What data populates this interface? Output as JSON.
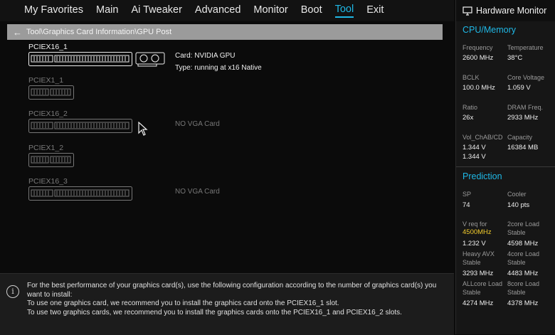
{
  "menu": [
    "My Favorites",
    "Main",
    "Ai Tweaker",
    "Advanced",
    "Monitor",
    "Boot",
    "Tool",
    "Exit"
  ],
  "active_menu": "Tool",
  "breadcrumb": "Tool\\Graphics Card Information\\GPU Post",
  "slots": [
    {
      "label": "PCIEX16_1",
      "card": "Card: NVIDIA GPU",
      "type": "Type: running at x16 Native"
    },
    {
      "label": "PCIEX1_1"
    },
    {
      "label": "PCIEX16_2",
      "status": "NO VGA Card"
    },
    {
      "label": "PCIEX1_2"
    },
    {
      "label": "PCIEX16_3",
      "status": "NO VGA Card"
    }
  ],
  "info": {
    "line1": "For the best performance of your graphics card(s), use the following configuration according to the number of graphics card(s) you",
    "line2": "want to install:",
    "line3": "To use one graphics card, we recommend you to install  the graphics card onto the PCIEX16_1 slot.",
    "line4": "To use two graphics cards, we recommend you to install the graphics cards onto the PCIEX16_1 and PCIEX16_2 slots."
  },
  "monitor": {
    "title": "Hardware Monitor",
    "cpu_title": "CPU/Memory",
    "frequency_label": "Frequency",
    "frequency": "2600 MHz",
    "temperature_label": "Temperature",
    "temperature": "38°C",
    "bclk_label": "BCLK",
    "bclk": "100.0 MHz",
    "core_voltage_label": "Core Voltage",
    "core_voltage": "1.059 V",
    "ratio_label": "Ratio",
    "ratio": "26x",
    "dram_label": "DRAM Freq.",
    "dram": "2933 MHz",
    "vol_label": "Vol_ChAB/CD",
    "vol1": "1.344 V",
    "vol2": "1.344 V",
    "capacity_label": "Capacity",
    "capacity": "16384 MB",
    "prediction_title": "Prediction",
    "sp_label": "SP",
    "sp": "74",
    "cooler_label": "Cooler",
    "cooler": "140 pts",
    "vreq_label": "V req for",
    "vreq_freq": "4500MHz",
    "vreq": "1.232 V",
    "core2_label1": "2core Load",
    "core2_label2": "Stable",
    "core2": "4598 MHz",
    "avx_label1": "Heavy AVX",
    "avx_label2": "Stable",
    "avx": "3293 MHz",
    "core4_label1": "4core Load",
    "core4_label2": "Stable",
    "core4": "4483 MHz",
    "allcore_label1": "ALLcore Load",
    "allcore_label2": "Stable",
    "allcore": "4274 MHz",
    "core8_label1": "8core Load",
    "core8_label2": "Stable",
    "core8": "4378 MHz"
  },
  "colors": {
    "accent": "#1fb8e6",
    "highlight": "#f1cb2d",
    "breadcrumb_bg": "#9b9b9b"
  }
}
